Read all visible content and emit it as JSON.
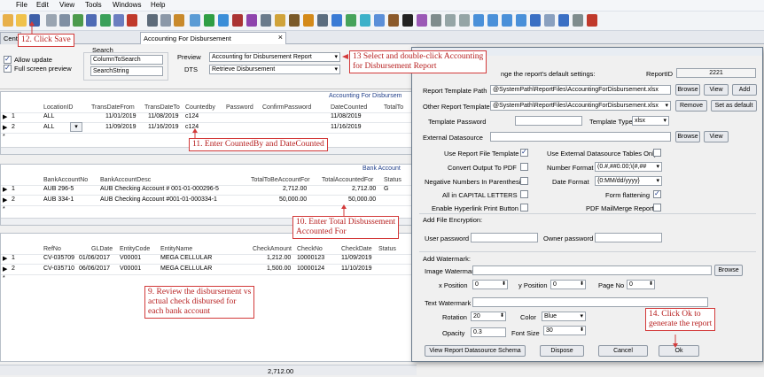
{
  "menu": [
    "File",
    "Edit",
    "View",
    "Tools",
    "Windows",
    "Help"
  ],
  "tabs": {
    "central": "Centra",
    "disbursement": "Accounting For Disbursement",
    "close": "×"
  },
  "filter": {
    "allow_update": "Allow update",
    "full_screen": "Full screen preview",
    "search_label": "Search",
    "search_field": "ColumnToSearch",
    "search_string": "SearchString",
    "preview_label": "Preview",
    "preview_value": "Accounting for Disbursement Report",
    "dts_label": "DTS",
    "dts_value": "Retrieve Disbursement"
  },
  "grid1": {
    "title": "Accounting For Disbursem",
    "headers": [
      "LocationID",
      "TransDateFrom",
      "TransDateTo",
      "Countedby",
      "Password",
      "ConfirmPassword",
      "DateCounted",
      "TotalTo"
    ],
    "rows": [
      [
        "1",
        "ALL",
        "11/01/2019",
        "11/08/2019",
        "c124",
        "",
        "",
        "11/08/2019"
      ],
      [
        "2",
        "ALL",
        "11/09/2019",
        "11/16/2019",
        "c124",
        "",
        "",
        "11/16/2019"
      ]
    ],
    "new_row": "*"
  },
  "grid2": {
    "title": "Bank Account",
    "headers": [
      "BankAccountNo",
      "BankAccountDesc",
      "TotalToBeAccountFor",
      "TotalAccountedFor",
      "Status"
    ],
    "rows": [
      [
        "1",
        "AUB 296-5",
        "AUB Checking Account # 001-01-000296-5",
        "2,712.00",
        "2,712.00",
        "G"
      ],
      [
        "2",
        "AUB 334-1",
        "AUB Checking Account #001-01-000334-1",
        "50,000.00",
        "50,000.00",
        ""
      ]
    ],
    "new_row": "*"
  },
  "grid3": {
    "headers": [
      "RefNo",
      "GLDate",
      "EntityCode",
      "EntityName",
      "CheckAmount",
      "CheckNo",
      "CheckDate",
      "Status"
    ],
    "rows": [
      [
        "1",
        "CV-035709",
        "01/06/2017",
        "V00001",
        "MEGA CELLULAR",
        "1,212.00",
        "10000123",
        "11/09/2019"
      ],
      [
        "2",
        "CV-035710",
        "06/06/2017",
        "V00001",
        "MEGA CELLULAR",
        "1,500.00",
        "10000124",
        "11/10/2019"
      ]
    ],
    "new_row": "*"
  },
  "status_total": "2,712.00",
  "callouts": {
    "c12": "12. Click Save",
    "c13_1": "13 Select and double-click Accounting",
    "c13_2": "for Disbursement Report",
    "c11": "11. Enter CountedBy and DateCounted",
    "c10_1": "10. Enter Total Disbussement",
    "c10_2": "Accounted For",
    "c9_1": "9. Review the disbursement vs",
    "c9_2": "actual check disbursed for",
    "c9_3": "each bank account",
    "c14_1": "14. Click Ok to",
    "c14_2": "generate the report"
  },
  "dialog": {
    "hint": "nge the report's default settings:",
    "report_id_label": "ReportID",
    "report_id": "2221",
    "template_path_label": "Report Template Path",
    "template_path": "@SystemPath\\ReportFiles\\AccountingForDisbursement.xlsx",
    "other_templates_label": "Other Report Templates",
    "other_templates": "@SystemPath\\ReportFiles\\AccountingForDisbursement.xlsx",
    "browse": "Browse",
    "view": "View",
    "add": "Add",
    "remove": "Remove",
    "set_default": "Set as default",
    "template_password_label": "Template Password",
    "template_type_label": "Template Type",
    "template_type": "xlsx",
    "external_datasource_label": "External Datasource",
    "use_file_template": "Use Report File Template",
    "use_external_tables": "Use External Datasource Tables Only",
    "convert_pdf": "Convert Output To PDF",
    "number_format_label": "Number Format",
    "number_format": "(0.#,##0.00;\\(#,##",
    "negative_paren": "Negative Numbers In Parenthesis",
    "date_format_label": "Date Format",
    "date_format": "{0:MM/dd/yyyy}",
    "all_caps": "All in CAPITAL LETTERS",
    "form_flattening": "Form flattening",
    "hyperlink": "Enable Hyperlink Print Button",
    "pdf_mailmerge": "PDF MailMerge Report",
    "file_encryption": "Add File Encryption:",
    "user_password": "User password",
    "owner_password": "Owner password",
    "add_watermark": "Add Watermark:",
    "image_watermark": "Image Watermark",
    "x_position": "x Position",
    "x_value": "0",
    "y_position": "y Position",
    "y_value": "0",
    "page_no": "Page No",
    "page_value": "0",
    "text_watermark": "Text Watermark",
    "rotation": "Rotation",
    "rotation_value": "20",
    "color": "Color",
    "color_value": "Blue",
    "opacity": "Opacity",
    "opacity_value": "0.3",
    "font_size": "Font Size",
    "font_size_value": "30",
    "schema_btn": "View Report Datasource Schema",
    "dispose_btn": "Dispose",
    "cancel_btn": "Cancel",
    "ok_btn": "Ok"
  },
  "colors": {
    "callout_border": "#d33a3a",
    "grid_title": "#1f3e8a"
  }
}
